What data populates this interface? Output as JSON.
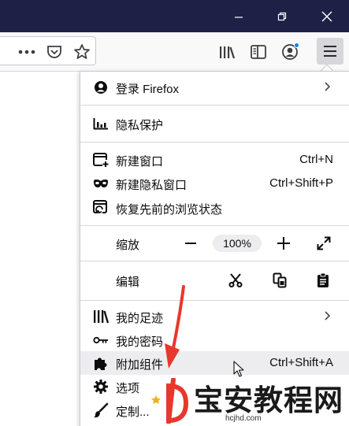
{
  "window": {
    "controls": [
      "restore-icon",
      "close-icon"
    ]
  },
  "toolbar": {
    "icons": [
      "more-dots-icon",
      "pocket-icon",
      "bookmark-star-icon",
      "library-icon",
      "sidebar-icon",
      "account-icon",
      "hamburger-menu-icon"
    ]
  },
  "menu": {
    "signin": {
      "label": "登录 Firefox",
      "icon": "account-icon"
    },
    "privacy": {
      "label": "隐私保护",
      "icon": "chart-icon"
    },
    "new_window": {
      "label": "新建窗口",
      "shortcut": "Ctrl+N",
      "icon": "new-window-icon"
    },
    "new_private": {
      "label": "新建隐私窗口",
      "shortcut": "Ctrl+Shift+P",
      "icon": "private-mask-icon"
    },
    "restore": {
      "label": "恢复先前的浏览状态",
      "icon": "restore-session-icon"
    },
    "zoom": {
      "label": "缩放",
      "minus": "−",
      "value": "100%",
      "plus": "+"
    },
    "edit": {
      "label": "编辑"
    },
    "library": {
      "label": "我的足迹",
      "icon": "library-icon"
    },
    "logins": {
      "label": "我的密码",
      "icon": "key-icon"
    },
    "addons": {
      "label": "附加组件",
      "shortcut": "Ctrl+Shift+A",
      "icon": "puzzle-icon"
    },
    "options": {
      "label": "选项",
      "icon": "gear-icon"
    },
    "customize": {
      "label": "定制...",
      "icon": "paintbrush-icon"
    }
  },
  "watermark": {
    "title": "宝安教程网",
    "url": "hcjhd.com"
  },
  "colors": {
    "titlebar": "#1f2045",
    "accent_dot": "#0a84ff",
    "arrow": "#e8372c",
    "highlight": "#ededf0"
  }
}
